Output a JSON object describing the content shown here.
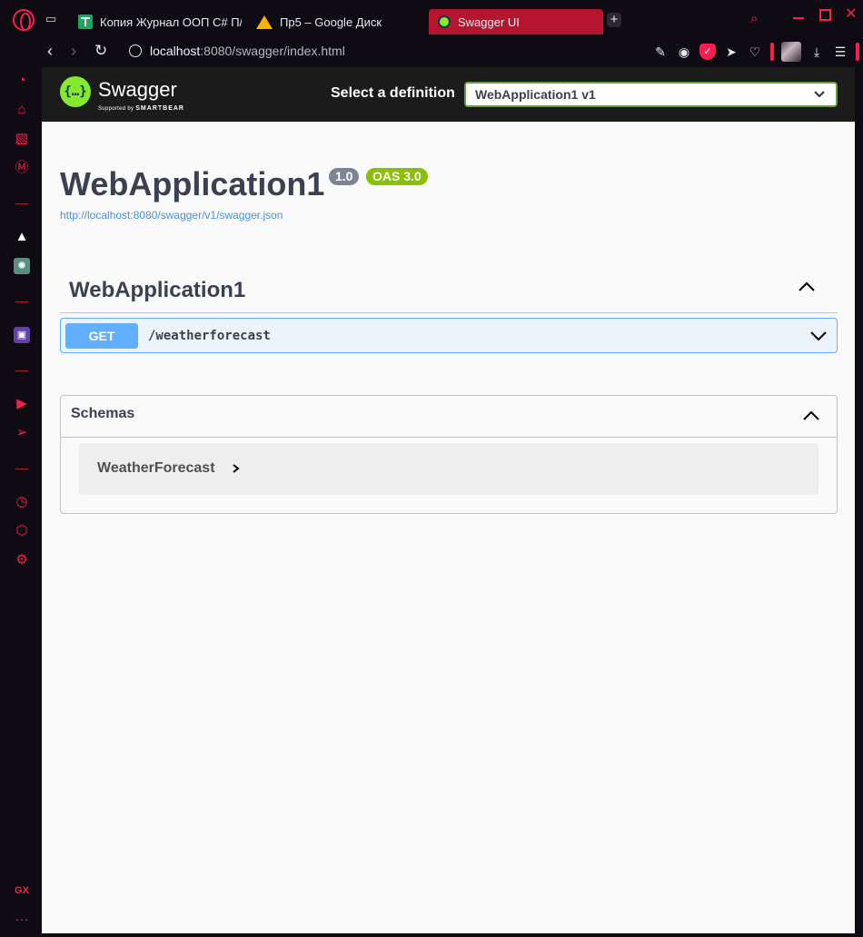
{
  "browser": {
    "tabs": [
      {
        "label": "Копия Журнал ООП C# П/"
      },
      {
        "label": "Пр5 – Google Диск"
      },
      {
        "label": "Swagger UI",
        "active": true
      }
    ],
    "url": {
      "host": "localhost",
      "rest": ":8080/swagger/index.html"
    },
    "accent_color": "#fa1e4e",
    "sidebar_bottom_label": "GX"
  },
  "swagger": {
    "brand": "Swagger",
    "supported_by": "Supported by",
    "supported_by_company": "SMARTBEAR",
    "definition_label": "Select a definition",
    "definition_selected": "WebApplication1 v1",
    "info": {
      "title": "WebApplication1",
      "version": "1.0",
      "oas": "OAS 3.0",
      "spec_url": "http://localhost:8080/swagger/v1/swagger.json"
    },
    "tag": {
      "name": "WebApplication1"
    },
    "operation": {
      "method": "GET",
      "path": "/weatherforecast",
      "method_color": "#61affe"
    },
    "schemas": {
      "title": "Schemas",
      "models": [
        {
          "name": "WeatherForecast"
        }
      ]
    }
  }
}
